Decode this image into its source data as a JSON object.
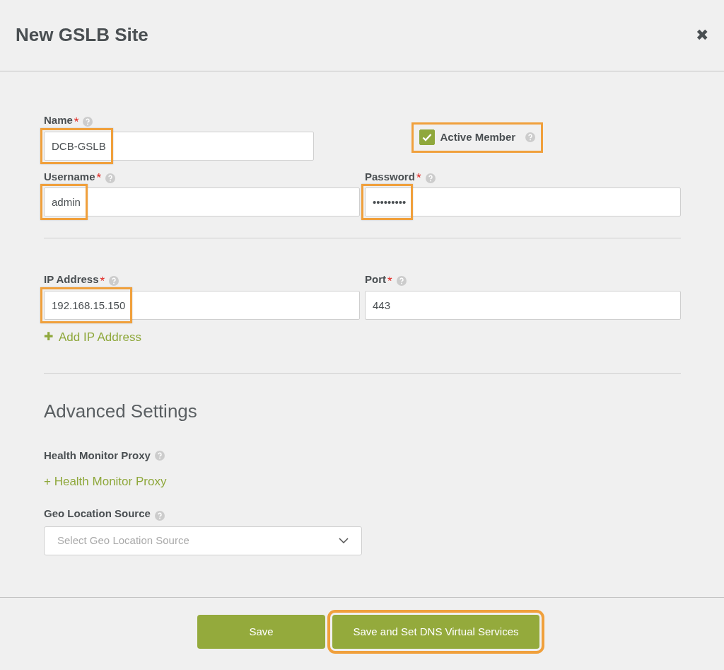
{
  "window": {
    "title": "New GSLB Site",
    "close": "✖"
  },
  "rows": [
    {
      "fields": [
        {
          "kind": "text",
          "label": "Name",
          "required_mark": "*",
          "value": "DCB-GSLB",
          "highlighted": true
        },
        {
          "kind": "checkbox",
          "label": "Active Member",
          "checked": true,
          "highlighted": true
        }
      ]
    },
    {
      "fields": [
        {
          "kind": "text",
          "label": "Username",
          "required_mark": "*",
          "value": "admin",
          "highlighted": true
        },
        {
          "kind": "text",
          "label": "Password",
          "required_mark": "*",
          "value": "•••••••••",
          "highlighted": true
        }
      ]
    },
    {
      "divider": true,
      "fields": [
        {
          "kind": "text",
          "label": "IP Address",
          "required_mark": "*",
          "value": "192.168.15.150",
          "highlighted": true
        },
        {
          "kind": "text",
          "label": "Port",
          "required_mark": "*",
          "value": "443",
          "highlighted": false
        }
      ]
    }
  ],
  "add_ip_link": {
    "icon": "✚",
    "label": "Add IP Address"
  },
  "advanced": {
    "title": "Advanced Settings",
    "health_monitor_proxy": {
      "label": "Health Monitor Proxy",
      "link": "+ Health Monitor Proxy"
    },
    "geo_location_source": {
      "label": "Geo Location Source",
      "placeholder": "Select Geo Location Source"
    }
  },
  "buttons": [
    {
      "label": "Save",
      "highlighted": false
    },
    {
      "label": "Save and Set DNS Virtual Services",
      "highlighted": true
    }
  ]
}
